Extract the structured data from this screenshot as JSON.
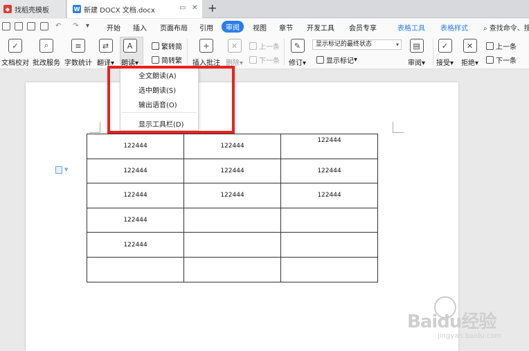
{
  "tabs": [
    {
      "label": "找稻壳模板"
    },
    {
      "label": "新建 DOCX 文档.docx"
    }
  ],
  "menu": {
    "items": [
      "开始",
      "插入",
      "页面布局",
      "引用",
      "审阅",
      "视图",
      "章节",
      "开发工具",
      "会员专享",
      "表格工具",
      "表格样式"
    ],
    "active": "审阅",
    "search_placeholder": "查找命令、搜"
  },
  "ribbon": {
    "doc_check": "文档校对",
    "revise_service": "批改服务",
    "word_count": "字数统计",
    "translate": "翻译",
    "read_aloud": "朗读",
    "trad_to_simp": "繁转简",
    "simp_to_trad": "简转繁",
    "insert_comment": "插入批注",
    "delete": "删除",
    "prev_comment": "上一条",
    "next_comment": "下一条",
    "revise": "修订",
    "markup_state": "显示标记的最终状态",
    "show_markup": "显示标记",
    "review": "审阅",
    "accept": "接受",
    "reject": "拒绝",
    "prev_change": "上一条",
    "next_change": "下一条"
  },
  "read_menu": {
    "items": [
      "全文朗读(A)",
      "选中朗读(S)",
      "输出语音(O)",
      "显示工具栏(D)"
    ]
  },
  "table": {
    "rows": [
      [
        "122444",
        "122444",
        "122444"
      ],
      [
        "122444",
        "122444",
        "122444"
      ],
      [
        "122444",
        "122444",
        "122444"
      ],
      [
        "122444",
        "",
        ""
      ],
      [
        "122444",
        "",
        ""
      ],
      [
        "",
        "",
        ""
      ]
    ]
  },
  "watermark": {
    "brand": "Baidu经验",
    "url": "jingyan.baidu.com"
  },
  "colors": {
    "accent": "#2b7de9",
    "highlight": "#e8221b"
  }
}
